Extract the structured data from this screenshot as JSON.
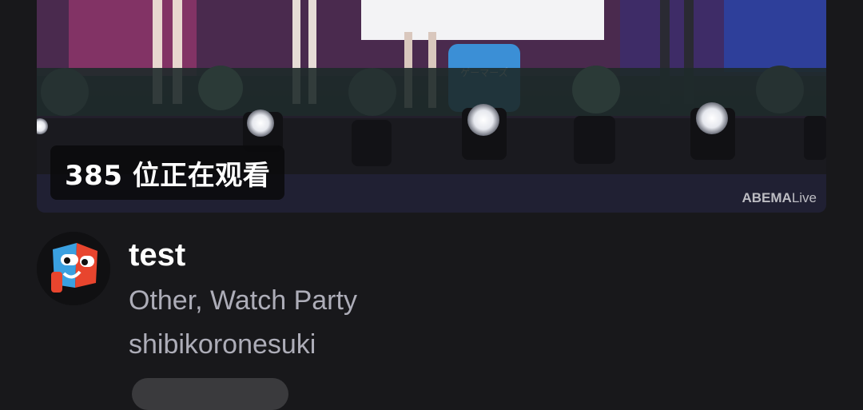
{
  "stream": {
    "viewer_count": "385 位正在观看",
    "watermark_bold": "ABEMA",
    "watermark_light": "Live",
    "title": "test",
    "category": "Other, Watch Party",
    "channel": "shibikoronesuki"
  },
  "colors": {
    "background": "#18181b",
    "title": "#ffffff",
    "secondary_text": "#adadb8",
    "badge_bg": "#0a0a0c"
  }
}
